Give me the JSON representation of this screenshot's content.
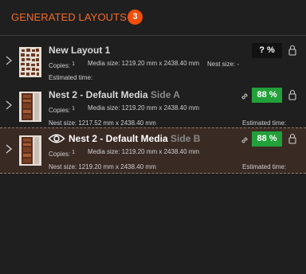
{
  "header": {
    "title": "GENERATED LAYOUTS",
    "count": "3"
  },
  "layouts": [
    {
      "title": "New Layout 1",
      "side": "",
      "copies_label": "Copies:",
      "copies_value": "1",
      "media_size": "Media size: 1219.20 mm x 2438.40 mm",
      "nest_size": "Nest size: -",
      "estimated_time": "Estimated time:",
      "percent": "? %",
      "selected": false
    },
    {
      "title": "Nest 2 - Default Media",
      "side": "Side A",
      "copies_label": "Copies:",
      "copies_value": "1",
      "media_size": "Media size: 1219.20 mm x 2438.40 mm",
      "nest_size": "Nest size: 1217.52 mm x 2438.40 mm",
      "estimated_time": "Estimated time:",
      "percent": "88 %",
      "selected": false
    },
    {
      "title": "Nest 2 - Default Media",
      "side": "Side B",
      "copies_label": "Copies:",
      "copies_value": "1",
      "media_size": "Media size: 1219.20 mm x 2438.40 mm",
      "nest_size": "Nest size: 1219.20 mm x 2438.40 mm",
      "estimated_time": "Estimated time:",
      "percent": "88 %",
      "selected": true
    }
  ],
  "colors": {
    "accent": "#f26a2a",
    "badge": "#f24e0c",
    "percent_good": "#22a03a",
    "selected_row": "#3a2a24",
    "background": "#1f1f1f"
  },
  "icons": [
    "chevron-right-icon",
    "lock-icon",
    "link-icon",
    "eye-icon"
  ]
}
